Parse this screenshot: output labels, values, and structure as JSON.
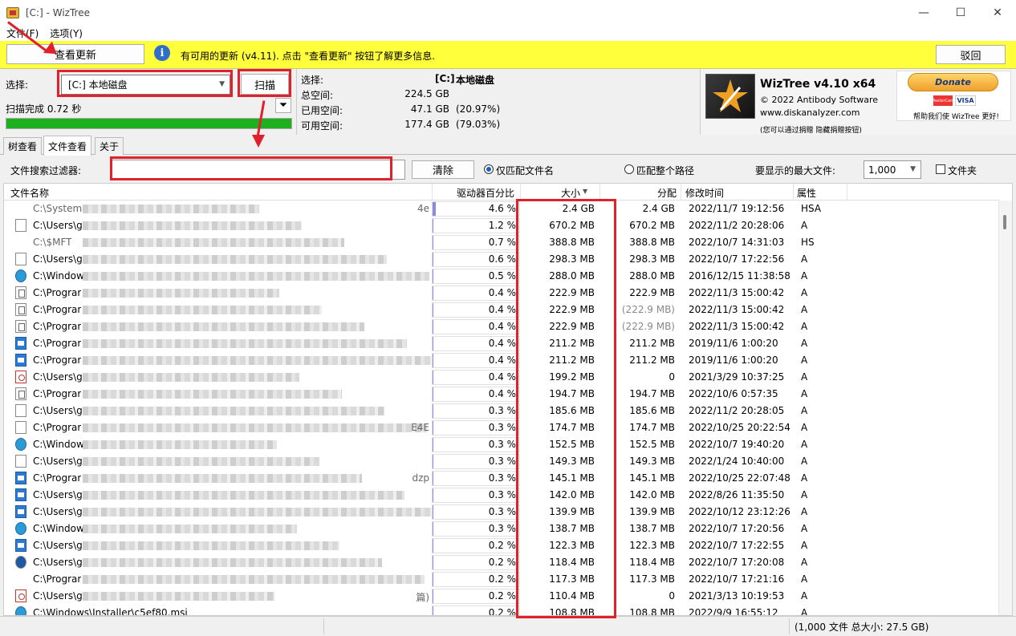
{
  "window": {
    "title": "[C:]  - WizTree",
    "minimize": "—",
    "maximize": "☐",
    "close": "✕"
  },
  "menu": {
    "file": "文件(F)",
    "options": "选项(Y)"
  },
  "update": {
    "check_button": "查看更新",
    "message": "有可用的更新 (v4.11). 点击 \"查看更新\" 按钮了解更多信息.",
    "dismiss_button": "驳回"
  },
  "select": {
    "label": "选择:",
    "drive_value": "[C:] 本地磁盘",
    "scan_button": "扫描",
    "scan_status": "扫描完成 0.72 秒",
    "progress": 1.0
  },
  "info": {
    "select_label": "选择:",
    "select_drive": "[C:]",
    "select_name": "本地磁盘",
    "total_label": "总空间:",
    "total_value": "224.5 GB",
    "used_label": "已用空间:",
    "used_value": "47.1 GB",
    "used_pct": "(20.97%)",
    "free_label": "可用空间:",
    "free_value": "177.4 GB",
    "free_pct": "(79.03%)"
  },
  "brand": {
    "name": "WizTree v4.10 x64",
    "copyright": "© 2022 Antibody Software",
    "site": "www.diskanalyzer.com",
    "note": "(您可以通过捐赠 隐藏捐赠按钮)",
    "donate": "Donate",
    "card1": "MasterCard",
    "card2": "VISA",
    "help": "帮助我们使 WizTree 更好!"
  },
  "tabs": [
    {
      "label": "树查看"
    },
    {
      "label": "文件查看"
    },
    {
      "label": "关于"
    }
  ],
  "filter": {
    "label": "文件搜索过滤器:",
    "value": "",
    "clear_button": "清除",
    "radio_name": "仅匹配文件名",
    "radio_path": "匹配整个路径",
    "max_label": "要显示的最大文件:",
    "max_value": "1,000",
    "folder_label": "文件夹"
  },
  "columns": {
    "name": "文件名称",
    "pct": "驱动器百分比",
    "size": "大小",
    "alloc": "分配",
    "modified": "修改时间",
    "attr": "属性"
  },
  "rows": [
    {
      "name": "C:\\System",
      "tail": "4e",
      "pct": "4.6 %",
      "pct_v": 4.6,
      "size": "2.4 GB",
      "alloc": "2.4 GB",
      "mod": "2022/11/7 19:12:56",
      "attr": "HSA",
      "icon": "none",
      "grey": true
    },
    {
      "name": "C:\\Users\\g",
      "tail": "",
      "pct": "1.2 %",
      "pct_v": 1.2,
      "size": "670.2 MB",
      "alloc": "670.2 MB",
      "mod": "2022/11/2 20:28:06",
      "attr": "A",
      "icon": "file",
      "grey": false
    },
    {
      "name": "C:\\$MFT",
      "tail": "",
      "pct": "0.7 %",
      "pct_v": 0.7,
      "size": "388.8 MB",
      "alloc": "388.8 MB",
      "mod": "2022/10/7 14:31:03",
      "attr": "HS",
      "icon": "none",
      "grey": true
    },
    {
      "name": "C:\\Users\\g",
      "tail": "",
      "pct": "0.6 %",
      "pct_v": 0.6,
      "size": "298.3 MB",
      "alloc": "298.3 MB",
      "mod": "2022/10/7 17:22:56",
      "attr": "A",
      "icon": "file",
      "grey": false
    },
    {
      "name": "C:\\Window",
      "tail": "",
      "pct": "0.5 %",
      "pct_v": 0.5,
      "size": "288.0 MB",
      "alloc": "288.0 MB",
      "mod": "2016/12/15 11:38:58",
      "attr": "A",
      "icon": "msi",
      "grey": false
    },
    {
      "name": "C:\\Prograr",
      "tail": "",
      "pct": "0.4 %",
      "pct_v": 0.4,
      "size": "222.9 MB",
      "alloc": "222.9 MB",
      "mod": "2022/11/3 15:00:42",
      "attr": "A",
      "icon": "cfg",
      "grey": false
    },
    {
      "name": "C:\\Prograr",
      "tail": "",
      "pct": "0.4 %",
      "pct_v": 0.4,
      "size": "222.9 MB",
      "alloc": "(222.9 MB)",
      "mod": "2022/11/3 15:00:42",
      "attr": "A",
      "icon": "cfg",
      "grey": false
    },
    {
      "name": "C:\\Prograr",
      "tail": "",
      "pct": "0.4 %",
      "pct_v": 0.4,
      "size": "222.9 MB",
      "alloc": "(222.9 MB)",
      "mod": "2022/11/3 15:00:42",
      "attr": "A",
      "icon": "cfg",
      "grey": false
    },
    {
      "name": "C:\\Prograr",
      "tail": "",
      "pct": "0.4 %",
      "pct_v": 0.4,
      "size": "211.2 MB",
      "alloc": "211.2 MB",
      "mod": "2019/11/6 1:00:20",
      "attr": "A",
      "icon": "exe",
      "grey": false
    },
    {
      "name": "C:\\Prograr",
      "tail": "",
      "pct": "0.4 %",
      "pct_v": 0.4,
      "size": "211.2 MB",
      "alloc": "211.2 MB",
      "mod": "2019/11/6 1:00:20",
      "attr": "A",
      "icon": "exe",
      "grey": false
    },
    {
      "name": "C:\\Users\\g",
      "tail": "",
      "pct": "0.4 %",
      "pct_v": 0.4,
      "size": "199.2 MB",
      "alloc": "0",
      "mod": "2021/3/29 10:37:25",
      "attr": "A",
      "icon": "pdf",
      "grey": false
    },
    {
      "name": "C:\\Prograr",
      "tail": "",
      "pct": "0.4 %",
      "pct_v": 0.4,
      "size": "194.7 MB",
      "alloc": "194.7 MB",
      "mod": "2022/10/6 0:57:35",
      "attr": "A",
      "icon": "cfg",
      "grey": false
    },
    {
      "name": "C:\\Users\\g",
      "tail": "",
      "pct": "0.3 %",
      "pct_v": 0.3,
      "size": "185.6 MB",
      "alloc": "185.6 MB",
      "mod": "2022/11/2 20:28:05",
      "attr": "A",
      "icon": "file",
      "grey": false
    },
    {
      "name": "C:\\Prograr",
      "tail": "E4E",
      "pct": "0.3 %",
      "pct_v": 0.3,
      "size": "174.7 MB",
      "alloc": "174.7 MB",
      "mod": "2022/10/25 20:22:54",
      "attr": "A",
      "icon": "file",
      "grey": false
    },
    {
      "name": "C:\\Window",
      "tail": "",
      "pct": "0.3 %",
      "pct_v": 0.3,
      "size": "152.5 MB",
      "alloc": "152.5 MB",
      "mod": "2022/10/7 19:40:20",
      "attr": "A",
      "icon": "msi",
      "grey": false
    },
    {
      "name": "C:\\Users\\g",
      "tail": "",
      "pct": "0.3 %",
      "pct_v": 0.3,
      "size": "149.3 MB",
      "alloc": "149.3 MB",
      "mod": "2022/1/24 10:40:00",
      "attr": "A",
      "icon": "file",
      "grey": false
    },
    {
      "name": "C:\\Prograr",
      "tail": "dzp",
      "pct": "0.3 %",
      "pct_v": 0.3,
      "size": "145.1 MB",
      "alloc": "145.1 MB",
      "mod": "2022/10/25 22:07:48",
      "attr": "A",
      "icon": "exe",
      "grey": false
    },
    {
      "name": "C:\\Users\\g",
      "tail": "",
      "pct": "0.3 %",
      "pct_v": 0.3,
      "size": "142.0 MB",
      "alloc": "142.0 MB",
      "mod": "2022/8/26 11:35:50",
      "attr": "A",
      "icon": "exe",
      "grey": false
    },
    {
      "name": "C:\\Users\\g",
      "tail": "",
      "pct": "0.3 %",
      "pct_v": 0.3,
      "size": "139.9 MB",
      "alloc": "139.9 MB",
      "mod": "2022/10/12 23:12:26",
      "attr": "A",
      "icon": "exe",
      "grey": false
    },
    {
      "name": "C:\\Window",
      "tail": "",
      "pct": "0.3 %",
      "pct_v": 0.3,
      "size": "138.7 MB",
      "alloc": "138.7 MB",
      "mod": "2022/10/7 17:20:56",
      "attr": "A",
      "icon": "msi",
      "grey": false
    },
    {
      "name": "C:\\Users\\g",
      "tail": "",
      "pct": "0.2 %",
      "pct_v": 0.2,
      "size": "122.3 MB",
      "alloc": "122.3 MB",
      "mod": "2022/10/7 17:22:55",
      "attr": "A",
      "icon": "exe",
      "grey": false
    },
    {
      "name": "C:\\Users\\g",
      "tail": "",
      "pct": "0.2 %",
      "pct_v": 0.2,
      "size": "118.4 MB",
      "alloc": "118.4 MB",
      "mod": "2022/10/7 17:20:08",
      "attr": "A",
      "icon": "cab",
      "grey": false
    },
    {
      "name": "C:\\Prograr",
      "tail": "",
      "pct": "0.2 %",
      "pct_v": 0.2,
      "size": "117.3 MB",
      "alloc": "117.3 MB",
      "mod": "2022/10/7 17:21:16",
      "attr": "A",
      "icon": "none",
      "grey": false
    },
    {
      "name": "C:\\Users\\g",
      "tail": "篇)",
      "pct": "0.2 %",
      "pct_v": 0.2,
      "size": "110.4 MB",
      "alloc": "0",
      "mod": "2021/3/13 10:19:53",
      "attr": "A",
      "icon": "pdf",
      "grey": false
    },
    {
      "name": "C:\\Windows\\Installer\\c5ef80.msi",
      "tail": "",
      "pct": "0.2 %",
      "pct_v": 0.2,
      "size": "108.8 MB",
      "alloc": "108.8 MB",
      "mod": "2022/9/9 16:55:12",
      "attr": "A",
      "icon": "msi",
      "grey": false
    }
  ],
  "status": {
    "summary": "(1,000 文件  总大小: 27.5 GB)"
  },
  "colors": {
    "update_bg": "#ffff3c",
    "progress": "#1fb01f",
    "annotation_red": "#e0202a",
    "pct_bar": "#8a8ae0"
  }
}
